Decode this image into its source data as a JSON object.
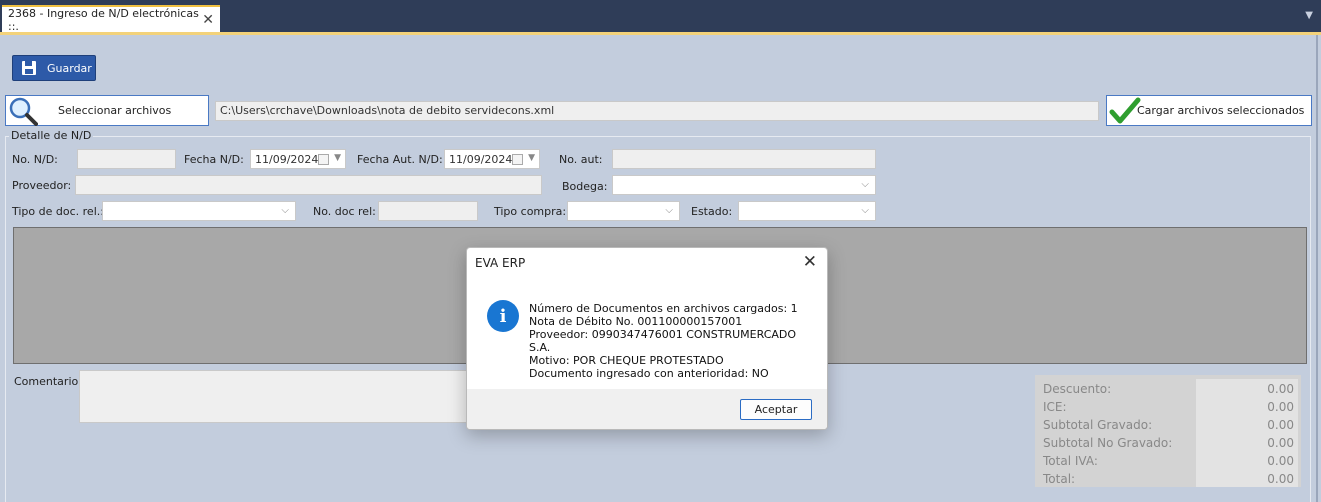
{
  "tab": {
    "title": "2368 - Ingreso de N/D electrónicas ::.",
    "close": "✕",
    "menu": "▼"
  },
  "toolbar": {
    "save_label": "Guardar"
  },
  "files": {
    "select_label": "Seleccionar archivos",
    "path": "C:\\Users\\crchave\\Downloads\\nota de debito servidecons.xml",
    "load_label": "Cargar archivos seleccionados"
  },
  "detail": {
    "legend": "Detalle de N/D",
    "no_nd_label": "No. N/D:",
    "fecha_nd_label": "Fecha N/D:",
    "fecha_nd_value": "11/09/2024",
    "fecha_aut_label": "Fecha Aut. N/D:",
    "fecha_aut_value": "11/09/2024",
    "no_aut_label": "No. aut:",
    "proveedor_label": "Proveedor:",
    "bodega_label": "Bodega:",
    "tipo_doc_label": "Tipo de doc. rel.:",
    "no_doc_rel_label": "No. doc rel:",
    "tipo_compra_label": "Tipo compra:",
    "estado_label": "Estado:"
  },
  "comentario_label": "Comentario:",
  "totals": [
    {
      "label": "Descuento:",
      "value": "0.00"
    },
    {
      "label": "ICE:",
      "value": "0.00"
    },
    {
      "label": "Subtotal Gravado:",
      "value": "0.00"
    },
    {
      "label": "Subtotal No Gravado:",
      "value": "0.00"
    },
    {
      "label": "Total IVA:",
      "value": "0.00"
    },
    {
      "label": "Total:",
      "value": "0.00"
    }
  ],
  "dialog": {
    "title": "EVA ERP",
    "close": "✕",
    "lines": [
      "Número de Documentos en archivos cargados: 1",
      "Nota de Débito No. 001100000157001",
      "Proveedor: 0990347476001 CONSTRUMERCADO S.A.",
      "Motivo: POR CHEQUE PROTESTADO",
      "Documento ingresado con anterioridad: NO"
    ],
    "ok_label": "Aceptar",
    "info_glyph": "i"
  },
  "colors": {
    "accent": "#f3d27a",
    "tab_bar": "#2f3d58",
    "panel": "#c3cddd",
    "info_blue": "#1976d2",
    "check_green": "#2f9e2f"
  }
}
